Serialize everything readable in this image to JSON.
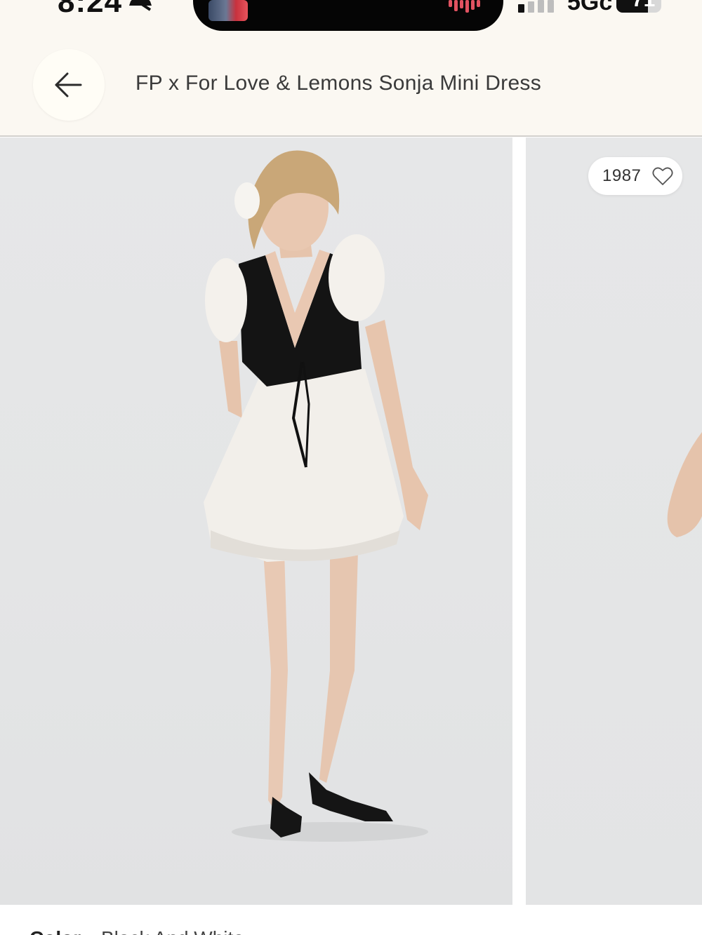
{
  "status_bar": {
    "time": "8:24",
    "network": "5Gc",
    "battery_level": "71",
    "battery_percent": 71,
    "icons": [
      "bell-off-icon",
      "signal-icon",
      "battery-icon"
    ]
  },
  "header": {
    "back_icon": "arrow-left-icon",
    "title": "FP x For Love & Lemons Sonja Mini Dress"
  },
  "gallery": {
    "like_count": "1987",
    "like_icon": "heart-outline-icon"
  },
  "details": {
    "color_label": "Color:",
    "color_value": "Black And White"
  },
  "colors": {
    "header_bg": "#fbf8f2",
    "photo_bg": "#e5e6e7",
    "text": "#3a3a3a"
  }
}
